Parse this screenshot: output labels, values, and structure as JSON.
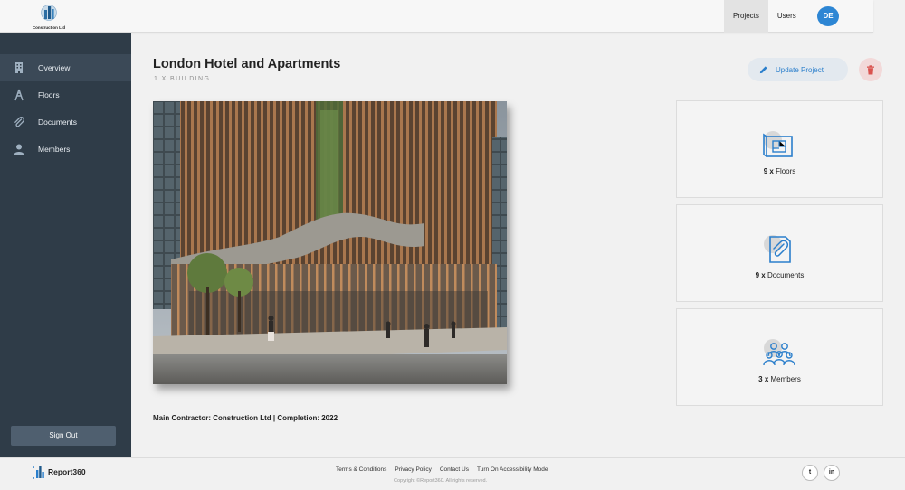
{
  "header": {
    "logo_text": "Construction Ltd",
    "nav": [
      {
        "label": "Projects",
        "active": true
      },
      {
        "label": "Users",
        "active": false
      }
    ],
    "avatar_initials": "DE"
  },
  "sidebar": {
    "items": [
      {
        "label": "Overview",
        "icon": "building-icon",
        "active": true
      },
      {
        "label": "Floors",
        "icon": "floors-icon",
        "active": false
      },
      {
        "label": "Documents",
        "icon": "paperclip-icon",
        "active": false
      },
      {
        "label": "Members",
        "icon": "person-icon",
        "active": false
      }
    ],
    "sign_out": "Sign Out"
  },
  "project": {
    "title": "London Hotel and Apartments",
    "subtitle": "1 X BUILDING",
    "update_label": "Update Project",
    "delete_icon": "trash-icon",
    "contractor_line": "Main Contractor: Construction Ltd | Completion: 2022"
  },
  "stats": [
    {
      "count": "9 x",
      "label": "Floors",
      "icon": "floorplan-icon"
    },
    {
      "count": "9 x",
      "label": "Documents",
      "icon": "paperclip-icon"
    },
    {
      "count": "3 x",
      "label": "Members",
      "icon": "group-icon"
    }
  ],
  "footer": {
    "brand": "Report360",
    "links": [
      "Terms & Conditions",
      "Privacy Policy",
      "Contact Us",
      "Turn On Accessibility Mode"
    ],
    "copyright": "Copyright ©Report360. All rights reserved.",
    "social": [
      {
        "label": "twitter",
        "glyph": "t"
      },
      {
        "label": "linkedin",
        "glyph": "in"
      }
    ]
  },
  "colors": {
    "accent": "#2b7fcc",
    "sidebar": "#2f3c48",
    "danger": "#d9534f"
  }
}
